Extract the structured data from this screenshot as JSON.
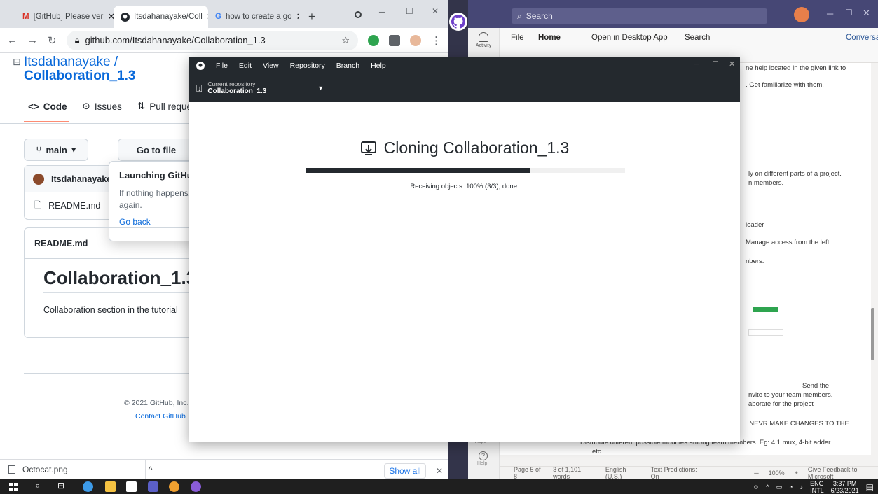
{
  "chrome": {
    "tabs": [
      {
        "label": "[GitHub] Please ver",
        "icon": "gmail-icon"
      },
      {
        "label": "Itsdahanayake/Coll",
        "icon": "github-icon"
      },
      {
        "label": "how to create a go",
        "icon": "google-icon"
      }
    ],
    "url": "github.com/Itsdahanayake/Collaboration_1.3"
  },
  "github": {
    "owner": "Itsdahanayake /",
    "repo": "Collaboration_1.3",
    "tabs": [
      "Code",
      "Issues",
      "Pull request"
    ],
    "branch": "main",
    "goto_file": "Go to file",
    "commit_author": "Itsdahanayake",
    "file_name": "README.md",
    "popup": {
      "title": "Launching GitHub",
      "line1": "If nothing happens,",
      "line2": "again.",
      "go_back": "Go back"
    },
    "readme_header": "README.md",
    "readme_title": "Collaboration_1.3",
    "readme_desc": "Collaboration section in the tutorial",
    "copyright": "© 2021 GitHub, Inc.",
    "contact": "Contact GitHub"
  },
  "download_bar": {
    "file": "Octocat.png",
    "show_all": "Show all"
  },
  "desktop": {
    "menu": [
      "File",
      "Edit",
      "View",
      "Repository",
      "Branch",
      "Help"
    ],
    "current_repo_label": "Current repository",
    "current_repo": "Collaboration_1.3",
    "cloning_title": "Cloning Collaboration_1.3",
    "progress": 0.7,
    "status": "Receiving objects: 100% (3/3), done."
  },
  "word": {
    "search": "Search",
    "ribbon_tabs": [
      "File",
      "Home",
      "Open in Desktop App",
      "Search",
      "Conversat"
    ],
    "rail_activity": "Activity",
    "rail_apps": "Apps",
    "rail_help": "Help",
    "doc_lines": [
      "ne help located in the given link to",
      ". Get familiarize with them.",
      "ly on different parts of a project.",
      "n members.",
      "leader",
      "Manage access from the left",
      "nbers.",
      "Send the",
      "nvite to your team members.",
      "aborate for the project",
      ". NEVR MAKE CHANGES TO THE",
      "Distribute different possible modules among team members. Eg: 4:1 mux, 4-bit adder...",
      "etc."
    ],
    "status": [
      "Page 5 of 8",
      "3 of 1,101 words",
      "English (U.S.)",
      "Text Predictions: On"
    ],
    "zoom": "100%",
    "feedback": "Give Feedback to Microsoft"
  },
  "taskbar": {
    "lang": "ENG",
    "lang2": "INTL",
    "time": "3:37 PM",
    "date": "6/23/2021"
  }
}
